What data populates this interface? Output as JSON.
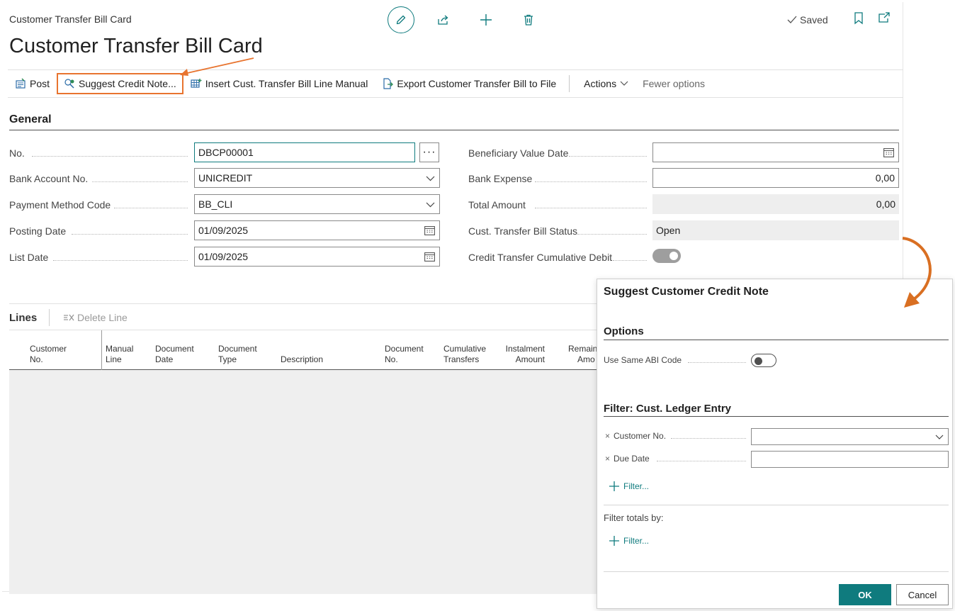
{
  "header": {
    "breadcrumb": "Customer Transfer Bill Card",
    "title": "Customer Transfer Bill Card",
    "saved_label": "Saved"
  },
  "action_bar": {
    "post": "Post",
    "suggest_credit_note": "Suggest Credit Note...",
    "insert_line_manual": "Insert Cust. Transfer Bill Line Manual",
    "export_to_file": "Export Customer Transfer Bill to File",
    "actions": "Actions",
    "fewer_options": "Fewer options"
  },
  "general": {
    "title": "General",
    "no": {
      "label": "No.",
      "value": "DBCP00001",
      "more": "···"
    },
    "bank_account_no": {
      "label": "Bank Account No.",
      "value": "UNICREDIT"
    },
    "payment_method_code": {
      "label": "Payment Method Code",
      "value": "BB_CLI"
    },
    "posting_date": {
      "label": "Posting Date",
      "value": "01/09/2025"
    },
    "list_date": {
      "label": "List Date",
      "value": "01/09/2025"
    },
    "beneficiary_value_date": {
      "label": "Beneficiary Value Date",
      "value": ""
    },
    "bank_expense": {
      "label": "Bank Expense",
      "value": "0,00"
    },
    "total_amount": {
      "label": "Total Amount",
      "value": "0,00"
    },
    "status": {
      "label": "Cust. Transfer Bill Status",
      "value": "Open"
    },
    "cumulative_debit": {
      "label": "Credit Transfer Cumulative Debit",
      "value": true
    }
  },
  "lines": {
    "title": "Lines",
    "delete_line": "Delete Line",
    "columns": [
      [
        "Customer",
        "No."
      ],
      [
        "Manual",
        "Line"
      ],
      [
        "Document",
        "Date"
      ],
      [
        "Document",
        "Type"
      ],
      [
        "Description",
        ""
      ],
      [
        "Document",
        "No."
      ],
      [
        "Cumulative",
        "Transfers"
      ],
      [
        "Instalment",
        "Amount"
      ],
      [
        "Remain",
        "Amo"
      ]
    ]
  },
  "dialog": {
    "title": "Suggest Customer Credit Note",
    "options_title": "Options",
    "use_same_abi_code": {
      "label": "Use Same ABI Code",
      "value": false
    },
    "filter_title": "Filter: Cust. Ledger Entry",
    "customer_no": {
      "label": "Customer No.",
      "value": ""
    },
    "due_date": {
      "label": "Due Date",
      "value": ""
    },
    "remove_symbol": "×",
    "filter_link": "Filter...",
    "filter_totals_by": "Filter totals by:",
    "filter_link_2": "Filter...",
    "ok": "OK",
    "cancel": "Cancel"
  },
  "colors": {
    "accent": "#0f7b7e",
    "highlight": "#e8742f"
  }
}
